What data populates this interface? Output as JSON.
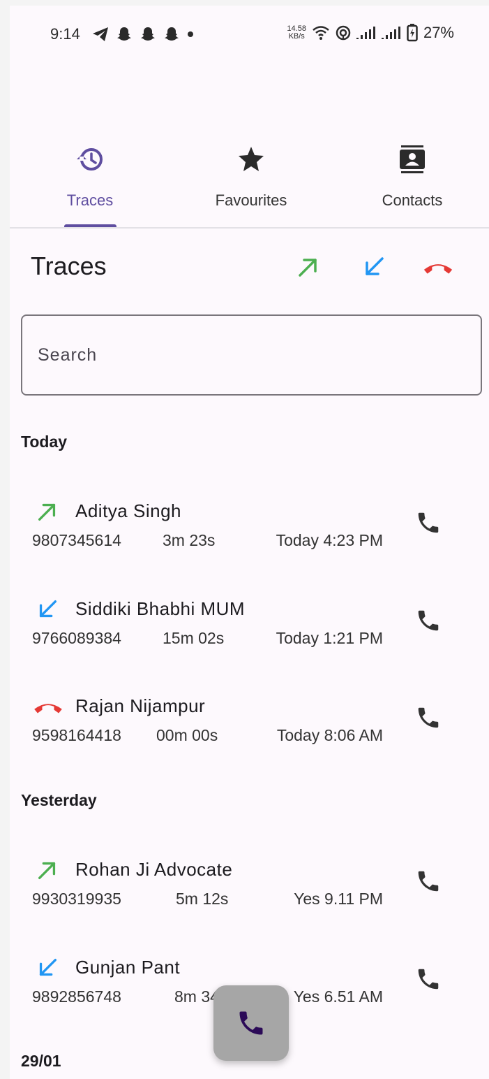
{
  "status_bar": {
    "time": "9:14",
    "speed_top": "14.58",
    "speed_bottom": "KB/s",
    "battery": "27%",
    "left_icons": [
      "telegram-icon",
      "snapchat-icon",
      "snapchat-icon",
      "snapchat-icon",
      "dot-icon"
    ],
    "right_icons": [
      "wifi-icon",
      "hotspot-icon",
      "signal-icon",
      "signal-icon",
      "battery-icon"
    ]
  },
  "tabs": [
    {
      "label": "Traces",
      "icon": "history-icon",
      "active": true
    },
    {
      "label": "Favourites",
      "icon": "star-icon",
      "active": false
    },
    {
      "label": "Contacts",
      "icon": "contact-card-icon",
      "active": false
    }
  ],
  "header": {
    "title": "Traces",
    "filters": [
      "outgoing-arrow-icon",
      "incoming-arrow-icon",
      "missed-call-icon"
    ]
  },
  "search": {
    "placeholder": "Search",
    "value": ""
  },
  "groups": [
    {
      "label": "Today",
      "calls": [
        {
          "type": "outgoing",
          "name": "Aditya Singh",
          "number": "9807345614",
          "duration": "3m 23s",
          "time": "Today 4:23 PM"
        },
        {
          "type": "incoming",
          "name": "Siddiki Bhabhi MUM",
          "number": "9766089384",
          "duration": "15m 02s",
          "time": "Today 1:21 PM"
        },
        {
          "type": "missed",
          "name": "Rajan Nijampur",
          "number": "9598164418",
          "duration": "00m 00s",
          "time": "Today 8:06 AM"
        }
      ]
    },
    {
      "label": "Yesterday",
      "calls": [
        {
          "type": "outgoing",
          "name": "Rohan Ji Advocate",
          "number": "9930319935",
          "duration": "5m 12s",
          "time": "Yes 9.11 PM"
        },
        {
          "type": "incoming",
          "name": "Gunjan Pant",
          "number": "9892856748",
          "duration": "8m 34s",
          "time": "Yes 6.51 AM"
        }
      ]
    },
    {
      "label": "29/01",
      "calls": []
    }
  ],
  "colors": {
    "accent": "#5f4ea0",
    "outgoing": "#4caf50",
    "incoming": "#2196f3",
    "missed": "#e53935",
    "fab": "#a6a6a6",
    "fab_icon": "#2b0a57"
  }
}
